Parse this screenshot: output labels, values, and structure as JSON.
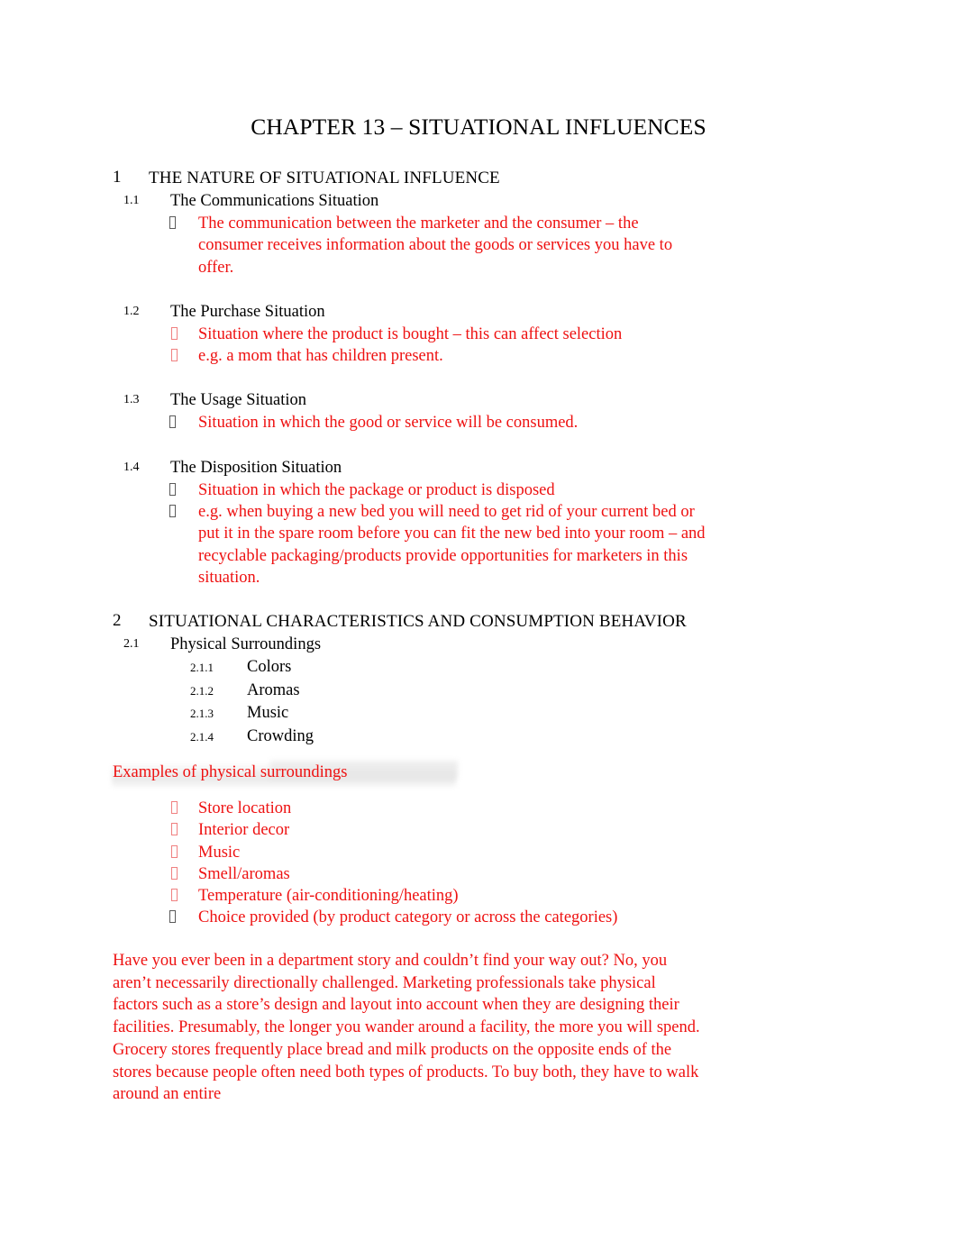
{
  "document": {
    "title": "CHAPTER 13 – SITUATIONAL INFLUENCES",
    "colors": {
      "body_text": "#000000",
      "accent_red": "#ee1111",
      "bullet_box_gray": "#5a5a5a",
      "bullet_box_red": "#f08080",
      "page_background": "#ffffff"
    },
    "bullet_glyph": "missing-glyph-box"
  },
  "section1": {
    "number": "1",
    "heading": "THE NATURE OF SITUATIONAL INFLUENCE",
    "items": [
      {
        "number": "1.1",
        "heading": "The Communications Situation",
        "bullets": [
          {
            "glyph": "missing-glyph-box",
            "glyph_color": "gray",
            "text": "The communication between the marketer and the consumer – the consumer receives information about the goods or services you have to offer."
          }
        ]
      },
      {
        "number": "1.2",
        "heading": "The Purchase Situation",
        "bullets": [
          {
            "glyph": "missing-glyph-box",
            "glyph_color": "red",
            "text": "Situation where the product is bought – this can affect selection"
          },
          {
            "glyph": "missing-glyph-box",
            "glyph_color": "red",
            "text": "e.g. a mom that has children present."
          }
        ]
      },
      {
        "number": "1.3",
        "heading": "The Usage Situation",
        "bullets": [
          {
            "glyph": "missing-glyph-box",
            "glyph_color": "gray",
            "text": "Situation in which the good or service will be consumed."
          }
        ]
      },
      {
        "number": "1.4",
        "heading": "The Disposition Situation",
        "bullets": [
          {
            "glyph": "missing-glyph-box",
            "glyph_color": "gray",
            "text": "Situation in which the package or product is disposed"
          },
          {
            "glyph": "missing-glyph-box",
            "glyph_color": "gray",
            "text": "e.g. when buying a new bed you will need to get rid of your current bed or put it in the spare room before you can fit the new bed into your room – and recyclable packaging/products provide opportunities for marketers in this situation."
          }
        ]
      }
    ]
  },
  "section2": {
    "number": "2",
    "heading": "SITUATIONAL CHARACTERISTICS AND CONSUMPTION BEHAVIOR",
    "item": {
      "number": "2.1",
      "heading": "Physical Surroundings",
      "subitems": [
        {
          "number": "2.1.1",
          "label": "Colors"
        },
        {
          "number": "2.1.2",
          "label": "Aromas"
        },
        {
          "number": "2.1.3",
          "label": "Music"
        },
        {
          "number": "2.1.4",
          "label": "Crowding"
        }
      ]
    }
  },
  "examples": {
    "heading": "Examples of physical surroundings",
    "bullets": [
      {
        "glyph": "missing-glyph-box",
        "glyph_color": "red",
        "text": "Store location"
      },
      {
        "glyph": "missing-glyph-box",
        "glyph_color": "red",
        "text": "Interior decor"
      },
      {
        "glyph": "missing-glyph-box",
        "glyph_color": "red",
        "text": "Music"
      },
      {
        "glyph": "missing-glyph-box",
        "glyph_color": "red",
        "text": "Smell/aromas"
      },
      {
        "glyph": "missing-glyph-box",
        "glyph_color": "red",
        "text": "Temperature (air-conditioning/heating)"
      },
      {
        "glyph": "missing-glyph-box",
        "glyph_color": "gray",
        "text": "Choice provided (by product category or across the categories)"
      }
    ]
  },
  "closing_paragraph": {
    "text": "Have you ever been in a department story and couldn’t find your way out? No, you aren’t necessarily directionally challenged. Marketing professionals take physical factors such as a store’s design and layout into account when they are designing their facilities. Presumably, the longer you wander around a facility, the more you will spend. Grocery stores frequently place bread and milk products on the opposite ends of the stores because people often need both types of products. To buy both, they have to walk around an entire"
  }
}
